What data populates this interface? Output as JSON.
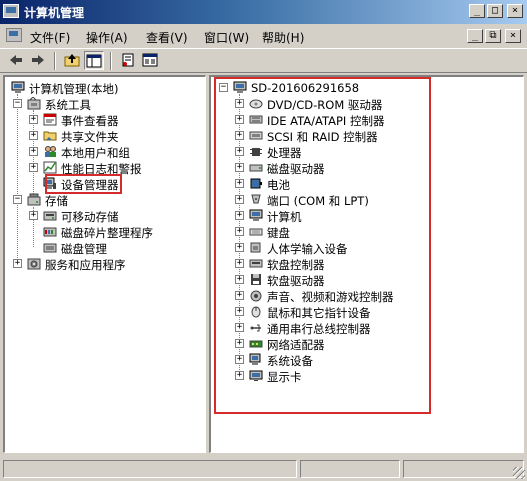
{
  "window": {
    "title": "计算机管理"
  },
  "menu": [
    "文件(F)",
    "操作(A)",
    "查看(V)",
    "窗口(W)",
    "帮助(H)"
  ],
  "title_buttons": {
    "minimize": "_",
    "maximize": "□",
    "close": "×"
  },
  "mdi_buttons": {
    "minimize": "_",
    "restore": "⧉",
    "close": "×"
  },
  "toolbar": {
    "back_icon": "back-arrow-icon",
    "forward_icon": "forward-arrow-icon",
    "up_icon": "up-folder-icon",
    "show_hide_tree_icon": "console-tree-icon",
    "properties_icon": "properties-icon",
    "help_icon": "help-icon"
  },
  "left_tree": {
    "root": "计算机管理(本地)",
    "system_tools": "系统工具",
    "event_viewer": "事件查看器",
    "shared_folders": "共享文件夹",
    "local_users": "本地用户和组",
    "perf_logs": "性能日志和警报",
    "device_manager": "设备管理器",
    "storage": "存储",
    "removable_storage": "可移动存储",
    "defrag": "磁盘碎片整理程序",
    "disk_mgmt": "磁盘管理",
    "services_apps": "服务和应用程序"
  },
  "right_tree": {
    "computer_name": "SD-201606291658",
    "devices": [
      {
        "label": "DVD/CD-ROM 驱动器",
        "icon": "cdrom-icon"
      },
      {
        "label": "IDE ATA/ATAPI 控制器",
        "icon": "ide-controller-icon"
      },
      {
        "label": "SCSI 和 RAID 控制器",
        "icon": "scsi-controller-icon"
      },
      {
        "label": "处理器",
        "icon": "processor-icon"
      },
      {
        "label": "磁盘驱动器",
        "icon": "disk-drive-icon"
      },
      {
        "label": "电池",
        "icon": "battery-icon"
      },
      {
        "label": "端口 (COM 和 LPT)",
        "icon": "port-icon"
      },
      {
        "label": "计算机",
        "icon": "computer-icon"
      },
      {
        "label": "键盘",
        "icon": "keyboard-icon"
      },
      {
        "label": "人体学输入设备",
        "icon": "hid-icon"
      },
      {
        "label": "软盘控制器",
        "icon": "floppy-controller-icon"
      },
      {
        "label": "软盘驱动器",
        "icon": "floppy-drive-icon"
      },
      {
        "label": "声音、视频和游戏控制器",
        "icon": "sound-icon"
      },
      {
        "label": "鼠标和其它指针设备",
        "icon": "mouse-icon"
      },
      {
        "label": "通用串行总线控制器",
        "icon": "usb-icon"
      },
      {
        "label": "网络适配器",
        "icon": "network-adapter-icon"
      },
      {
        "label": "系统设备",
        "icon": "system-devices-icon"
      },
      {
        "label": "显示卡",
        "icon": "display-adapter-icon"
      }
    ]
  },
  "colors": {
    "titlebar_start": "#0a246a",
    "titlebar_end": "#a6caf0",
    "highlight_box": "#d62b2b",
    "face": "#d4d0c8"
  }
}
